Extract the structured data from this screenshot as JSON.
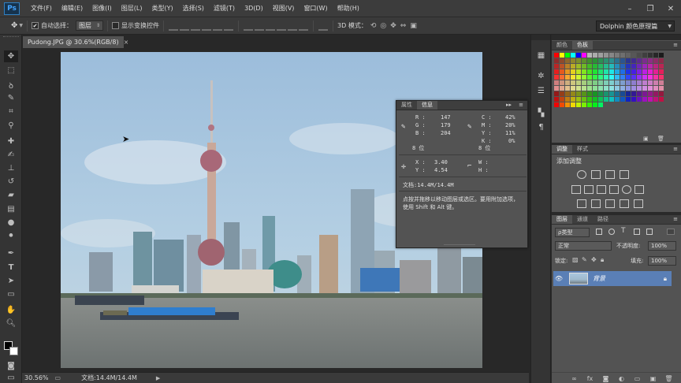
{
  "app": {
    "logo": "Ps"
  },
  "menubar": {
    "items": [
      "文件(F)",
      "编辑(E)",
      "图像(I)",
      "图层(L)",
      "类型(Y)",
      "选择(S)",
      "滤镜(T)",
      "3D(D)",
      "视图(V)",
      "窗口(W)",
      "帮助(H)"
    ],
    "controls": [
      "–",
      "❐",
      "✕"
    ]
  },
  "options": {
    "auto_select_label": "自动选择：",
    "auto_select_checked": "✔",
    "auto_select_value": "图层",
    "show_transform_label": "显示变换控件",
    "mode_3d_label": "3D 模式：",
    "workspace": "Dolphin 颜色原理篇"
  },
  "document": {
    "tab_label": "Pudong.JPG @ 30.6%(RGB/8)",
    "tab_close": "×",
    "zoom": "30.56%",
    "doc_size": "文档:14.4M/14.4M"
  },
  "info_panel": {
    "tabs": [
      "属性",
      "信息"
    ],
    "r_label": "R :",
    "r_value": "147",
    "g_label": "G :",
    "g_value": "179",
    "b_label": "B :",
    "b_value": "204",
    "c_label": "C :",
    "c_value": "42%",
    "m_label": "M :",
    "m_value": "20%",
    "y_label": "Y :",
    "y_value": "11%",
    "k_label": "K :",
    "k_value": "0%",
    "bits_left": "8 位",
    "bits_right": "8 位",
    "x_label": "X :",
    "x_value": "3.40",
    "yy_label": "Y :",
    "yy_value": "4.54",
    "w_label": "W :",
    "h_label": "H :",
    "doc_info": "文档:14.4M/14.4M",
    "hint": "点按并拖移以移动图层或选区。要用附加选项，使用 Shift 和 Alt 键。"
  },
  "color_panel": {
    "tabs": [
      "颜色",
      "色板"
    ]
  },
  "adjust_panel": {
    "tabs": [
      "调整",
      "样式"
    ],
    "title": "添加调整"
  },
  "layers_panel": {
    "tabs": [
      "图层",
      "通道",
      "路径"
    ],
    "kind_filter": "ρ类型",
    "blend_mode": "正常",
    "opacity_label": "不透明度:",
    "opacity_value": "100%",
    "lock_label": "锁定:",
    "fill_label": "填充:",
    "fill_value": "100%",
    "layer_name": "背景"
  },
  "colors": {
    "accent": "#5a7fb6",
    "sky": "#a9c6de",
    "water": "#787e80"
  }
}
